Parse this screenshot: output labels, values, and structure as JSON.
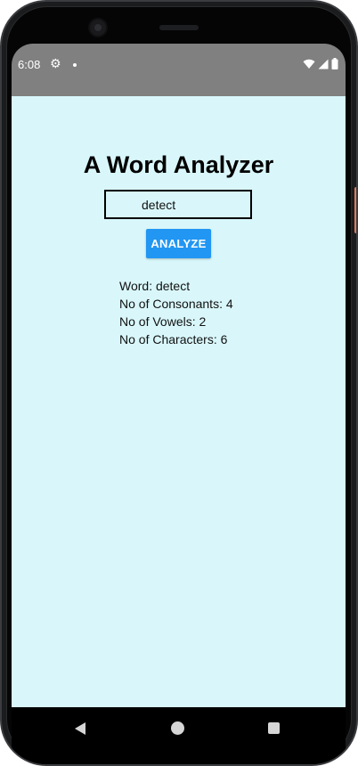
{
  "status_bar": {
    "time": "6:08",
    "icons": [
      "settings-icon",
      "notification-dot",
      "wifi-icon",
      "signal-icon",
      "battery-icon"
    ]
  },
  "app": {
    "title": "A Word Analyzer",
    "input": {
      "value": "detect",
      "placeholder": ""
    },
    "analyze_label": "ANALYZE",
    "results": {
      "word": "Word: detect",
      "consonants": "No of Consonants: 4",
      "vowels": "No of Vowels: 2",
      "characters": "No of Characters: 6"
    }
  },
  "colors": {
    "background": "#d9f7fb",
    "status_bar": "#808080",
    "button": "#2196f3"
  },
  "nav": {
    "icons": [
      "back-icon",
      "home-icon",
      "recents-icon"
    ]
  }
}
